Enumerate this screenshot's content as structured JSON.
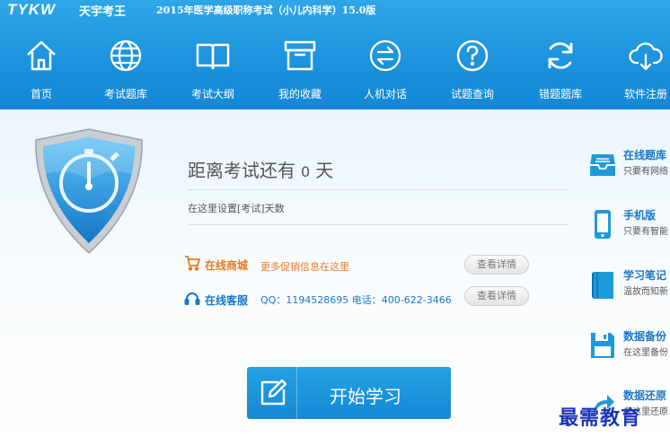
{
  "titlebar": {
    "logo": "TYKW",
    "brand": "天宇考王",
    "app_title": "2015年医学高级职称考试（小儿内科学）15.0版"
  },
  "nav": [
    {
      "label": "首页",
      "icon": "home-icon"
    },
    {
      "label": "考试题库",
      "icon": "globe-icon"
    },
    {
      "label": "考试大纲",
      "icon": "book-icon"
    },
    {
      "label": "我的收藏",
      "icon": "archive-box-icon"
    },
    {
      "label": "人机对话",
      "icon": "exchange-arrows-icon"
    },
    {
      "label": "试题查询",
      "icon": "question-circle-icon"
    },
    {
      "label": "错题题库",
      "icon": "refresh-icon"
    },
    {
      "label": "软件注册",
      "icon": "cloud-download-icon"
    }
  ],
  "countdown": {
    "prefix": "距离考试还有",
    "days": "0",
    "suffix": "天",
    "set_link": "在这里设置[考试]天数"
  },
  "shop": {
    "label": "在线商城",
    "desc": "更多促销信息在这里",
    "button": "查看详情",
    "color": "#e8791e"
  },
  "service": {
    "label": "在线客服",
    "desc": "QQ：1194528695 电话：400-622-3466",
    "button": "查看详情",
    "color": "#1a78c6"
  },
  "start_button": {
    "label": "开始学习"
  },
  "side": [
    {
      "title": "在线题库",
      "desc": "只要有网络",
      "icon": "inbox-tray-icon"
    },
    {
      "title": "手机版",
      "desc": "只要有智能",
      "icon": "mobile-phone-icon"
    },
    {
      "title": "学习笔记",
      "desc": "温故而知新",
      "icon": "notebook-icon"
    },
    {
      "title": "数据备份",
      "desc": "在这里备份",
      "icon": "floppy-disk-icon"
    },
    {
      "title": "数据还原",
      "desc": "在这里还原",
      "icon": "restore-arrow-icon"
    }
  ],
  "watermark": "最需教育",
  "colors": {
    "accent": "#1b92dc",
    "link_blue": "#1a78c6",
    "orange": "#e8791e"
  }
}
